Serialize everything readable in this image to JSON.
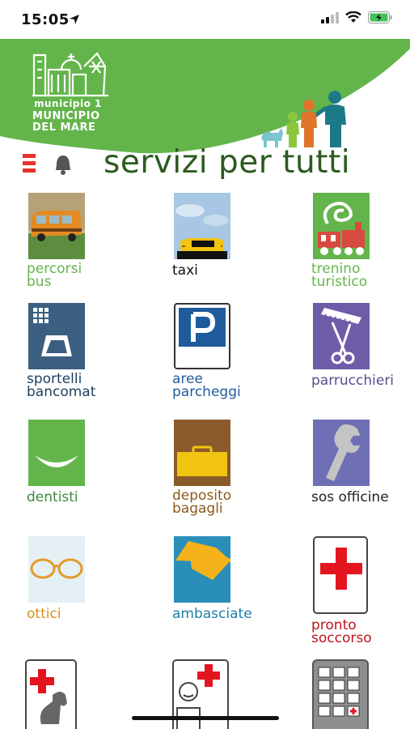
{
  "status_bar": {
    "time": "15:05"
  },
  "header": {
    "logo_line1": "municipio 1",
    "logo_line2": "MUNICIPIO",
    "logo_line3": "DEL MARE",
    "slogan": "servizi per tutti",
    "brand_color": "#63b54b",
    "slogan_color": "#2c5a1f"
  },
  "services": [
    {
      "label_line1": "percorsi",
      "label_line2": "bus",
      "color": "#63b54b",
      "icon": "bus-icon"
    },
    {
      "label_line1": "taxi",
      "label_line2": "",
      "color": "#111111",
      "icon": "taxi-icon"
    },
    {
      "label_line1": "trenino",
      "label_line2": "turistico",
      "color": "#63b54b",
      "icon": "train-icon"
    },
    {
      "label_line1": "sportelli",
      "label_line2": "bancomat",
      "color": "#1c3f5e",
      "icon": "atm-icon"
    },
    {
      "label_line1": "aree",
      "label_line2": "parcheggi",
      "color": "#1f5b9c",
      "icon": "parking-icon"
    },
    {
      "label_line1": "parrucchieri",
      "label_line2": "",
      "color": "#5b4a8a",
      "icon": "scissors-comb-icon"
    },
    {
      "label_line1": "dentisti",
      "label_line2": "",
      "color": "#3d8a3a",
      "icon": "dentist-smile-icon"
    },
    {
      "label_line1": "deposito",
      "label_line2": "bagagli",
      "color": "#8b5a1a",
      "icon": "suitcase-icon"
    },
    {
      "label_line1": "sos officine",
      "label_line2": "",
      "color": "#222222",
      "icon": "wrench-icon"
    },
    {
      "label_line1": "ottici",
      "label_line2": "",
      "color": "#d9901f",
      "icon": "glasses-icon"
    },
    {
      "label_line1": "ambasciate",
      "label_line2": "",
      "color": "#1f7fa8",
      "icon": "flag-icon"
    },
    {
      "label_line1": "pronto",
      "label_line2": "soccorso",
      "color": "#c0121b",
      "icon": "red-cross-icon"
    }
  ]
}
